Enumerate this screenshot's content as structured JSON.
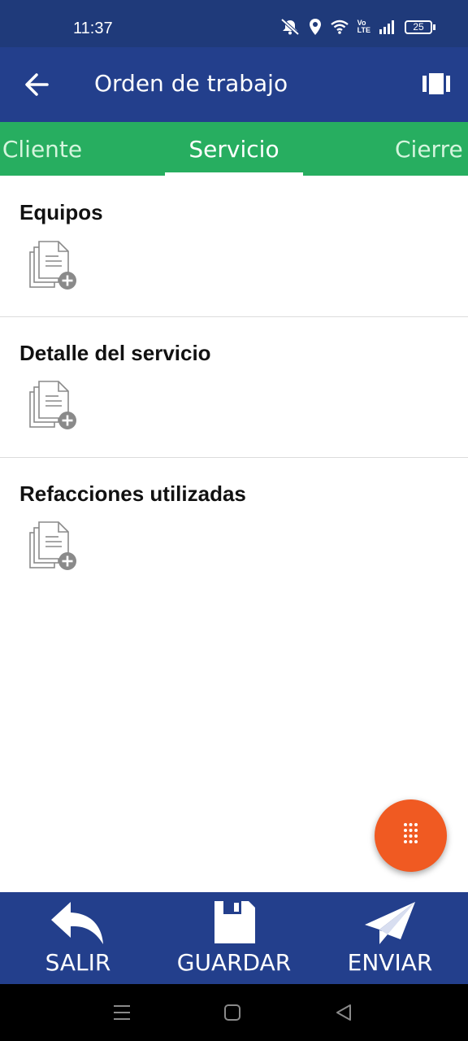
{
  "status_bar": {
    "time": "11:37",
    "battery": "25",
    "network_label_top": "Vo",
    "network_label_bottom": "LTE"
  },
  "app_bar": {
    "title": "Orden de trabajo",
    "back_icon": "arrow-left-icon",
    "action_icon": "cards-icon"
  },
  "tabs": [
    {
      "label": "Cliente",
      "active": false
    },
    {
      "label": "Servicio",
      "active": true
    },
    {
      "label": "Cierre",
      "active": false
    }
  ],
  "sections": [
    {
      "title": "Equipos",
      "icon": "add-document-icon"
    },
    {
      "title": "Detalle del servicio",
      "icon": "add-document-icon"
    },
    {
      "title": "Refacciones utilizadas",
      "icon": "add-document-icon"
    }
  ],
  "fab": {
    "icon": "dial-pad-icon"
  },
  "bottom_bar": {
    "salir": "SALIR",
    "guardar": "GUARDAR",
    "enviar": "ENVIAR"
  },
  "colors": {
    "status_bar": "#1f3a7a",
    "app_bar": "#233f8c",
    "tabs": "#27ae60",
    "fab": "#f05a22",
    "nav_bar": "#000000"
  }
}
